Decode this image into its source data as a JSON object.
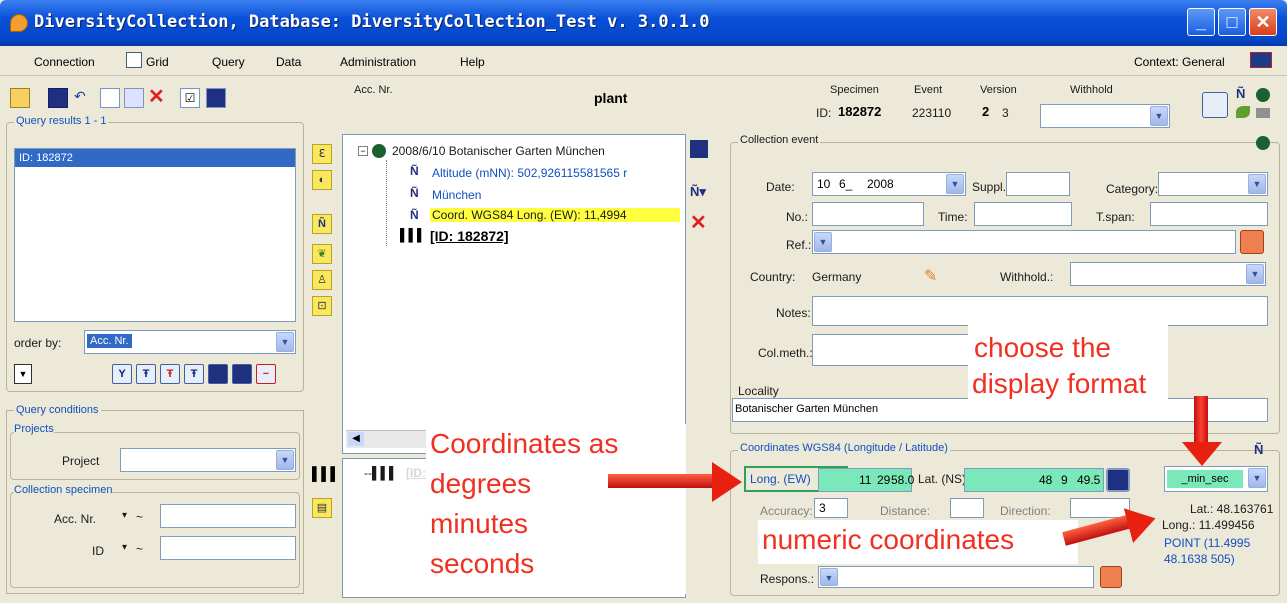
{
  "window": {
    "title": "DiversityCollection, Database: DiversityCollection_Test   v. 3.0.1.0"
  },
  "menu": {
    "connection": "Connection",
    "grid": "Grid",
    "query": "Query",
    "data": "Data",
    "administration": "Administration",
    "help": "Help",
    "context": "Context: General"
  },
  "query_results": {
    "legend": "Query results  1 - 1",
    "items": [
      "ID: 182872"
    ],
    "order_by_label": "order by:",
    "order_by_value": "Acc. Nr."
  },
  "query_conditions": {
    "legend": "Query conditions",
    "projects_legend": "Projects",
    "project_label": "Project",
    "specimen_legend": "Collection specimen",
    "acc_label": "Acc. Nr.",
    "id_label": "ID",
    "op": "~"
  },
  "header": {
    "acc_label": "Acc. Nr.",
    "title": "plant",
    "specimen_label": "Specimen",
    "event_label": "Event",
    "version_label": "Version",
    "withhold_label": "Withhold",
    "id_label": "ID:",
    "specimen_id": "182872",
    "event_id": "223110",
    "version_a": "2",
    "version_b": "3"
  },
  "tree": {
    "root": "2008/6/10 Botanischer Garten München",
    "altitude": "Altitude (mNN): 502,926115581565 r",
    "place": "München",
    "coord": "Coord. WGS84 Long. (EW): 11,4994",
    "specimen": "[ID: 182872]"
  },
  "lower_tree": {
    "item": "[ID: 182872]"
  },
  "collection_event": {
    "legend": "Collection event",
    "date_label": "Date:",
    "date_day": "10",
    "date_month": "6_",
    "date_year": "2008",
    "suppl_label": "Suppl.:",
    "category_label": "Category:",
    "no_label": "No.:",
    "time_label": "Time:",
    "tspan_label": "T.span:",
    "ref_label": "Ref.:",
    "country_label": "Country:",
    "country_value": "Germany",
    "withhold_label": "Withhold.:",
    "notes_label": "Notes:",
    "colmeth_label": "Col.meth.:",
    "locality_label": "Locality",
    "locality_value": "Botanischer Garten München"
  },
  "coordinates": {
    "legend": "Coordinates WGS84 (Longitude / Latitude)",
    "long_label": "Long. (EW)",
    "long_deg": "11",
    "long_min": "29",
    "long_sec": "58.0",
    "lat_label": "Lat. (NS)",
    "lat_deg": "48",
    "lat_min": "9",
    "lat_sec": "49.5",
    "format": "_min_sec",
    "accuracy_label": "Accuracy:",
    "accuracy_value": "3",
    "distance_label": "Distance:",
    "direction_label": "Direction:",
    "lat_numeric": "Lat.: 48.163761",
    "long_numeric": "Long.: 11.499456",
    "point": "POINT (11.4995",
    "point2": "48.1638 505)",
    "respons_label": "Respons.:"
  },
  "annotations": {
    "choose1": "choose the",
    "choose2": "display format",
    "coords1": "Coordinates as",
    "coords2": "degrees",
    "coords3": "minutes",
    "coords4": "seconds",
    "numeric": "numeric coordinates"
  },
  "colors": {
    "accent": "#0a50d8",
    "annotation": "#f03020",
    "highlight": "#ffff40",
    "green_field": "#7ae8b8"
  }
}
